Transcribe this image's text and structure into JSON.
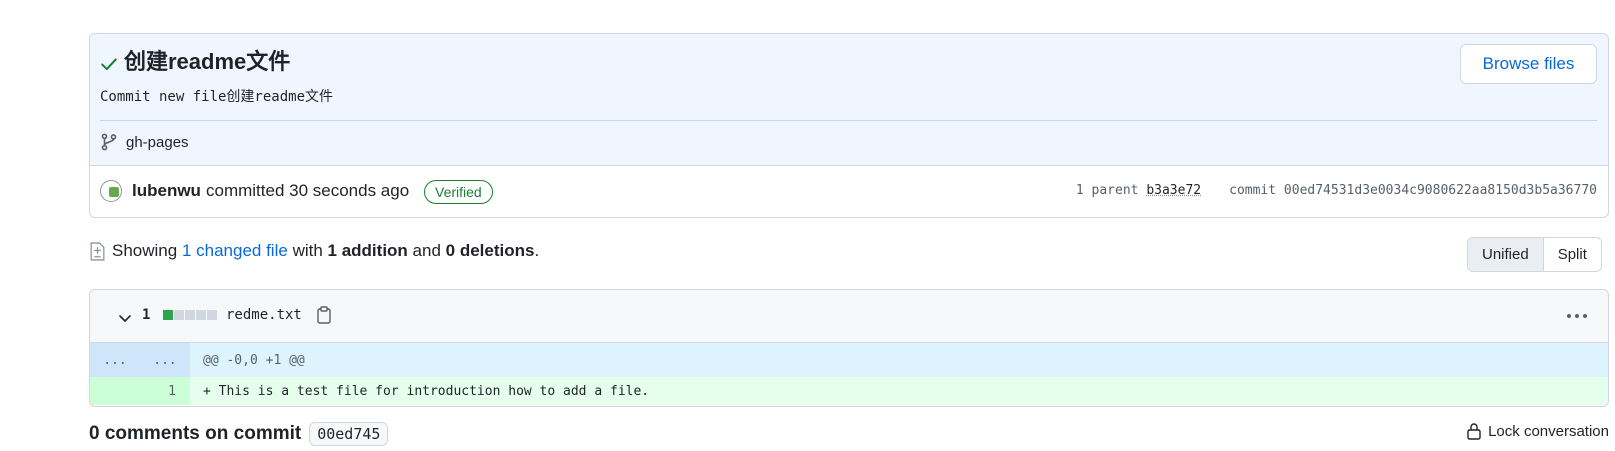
{
  "commit": {
    "title": "创建readme文件",
    "description": "Commit new file创建readme文件",
    "browse_label": "Browse files",
    "branch": "gh-pages",
    "author": "lubenwu",
    "committed_text": "committed 30 seconds ago",
    "verified_label": "Verified",
    "parent_label": "1 parent",
    "parent_sha": "b3a3e72",
    "commit_label": "commit",
    "commit_sha": "00ed74531d3e0034c9080622aa8150d3b5a36770"
  },
  "summary": {
    "prefix": "Showing",
    "changed_files": "1 changed file",
    "with": "with",
    "additions": "1 addition",
    "and": "and",
    "deletions": "0 deletions",
    "suffix": "."
  },
  "view_toggle": {
    "unified": "Unified",
    "split": "Split",
    "selected": "Unified"
  },
  "file": {
    "change_count": "1",
    "name": "redme.txt",
    "hunk_left": "...",
    "hunk_right": "...",
    "hunk_header": "@@ -0,0 +1 @@",
    "line_number": "1",
    "added_line": "+ This is a test file for introduction how to add a file."
  },
  "comments": {
    "title": "0 comments on commit",
    "sha": "00ed745",
    "lock_label": "Lock conversation"
  },
  "colors": {
    "accent": "#0969da",
    "success": "#1a7f37",
    "addition_bg": "#e6ffec"
  }
}
